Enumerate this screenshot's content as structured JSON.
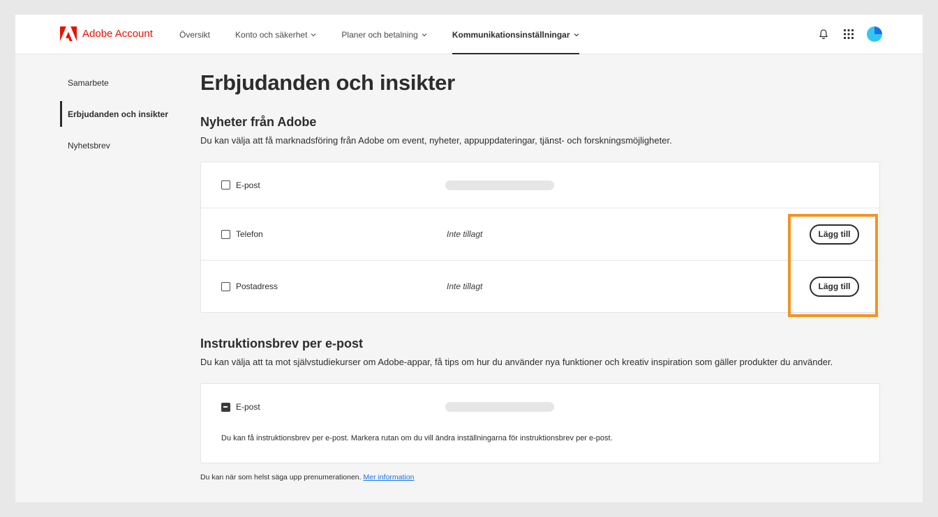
{
  "header": {
    "brand": "Adobe Account",
    "nav": [
      {
        "label": "Översikt",
        "dropdown": false,
        "active": false
      },
      {
        "label": "Konto och säkerhet",
        "dropdown": true,
        "active": false
      },
      {
        "label": "Planer och betalning",
        "dropdown": true,
        "active": false
      },
      {
        "label": "Kommunikationsinställningar",
        "dropdown": true,
        "active": true
      }
    ],
    "icons": [
      "bell-icon",
      "app-grid-icon",
      "avatar"
    ]
  },
  "sidebar": {
    "items": [
      {
        "label": "Samarbete",
        "active": false
      },
      {
        "label": "Erbjudanden och insikter",
        "active": true
      },
      {
        "label": "Nyhetsbrev",
        "active": false
      }
    ]
  },
  "main": {
    "title": "Erbjudanden och insikter",
    "news": {
      "title": "Nyheter från Adobe",
      "description": "Du kan välja att få marknadsföring från Adobe om event, nyheter, appuppdateringar, tjänst- och forskningsmöjligheter.",
      "rows": [
        {
          "label": "E-post",
          "value": "",
          "redacted": true,
          "checked": false
        },
        {
          "label": "Telefon",
          "value": "Inte tillagt",
          "button": "Lägg till",
          "checked": false
        },
        {
          "label": "Postadress",
          "value": "Inte tillagt",
          "button": "Lägg till",
          "checked": false
        }
      ]
    },
    "instructions": {
      "title": "Instruktionsbrev per e-post",
      "description": "Du kan välja att ta mot självstudiekurser om Adobe-appar, få tips om hur du använder nya funktioner och kreativ inspiration som gäller produkter du använder.",
      "row": {
        "label": "E-post",
        "redacted": true,
        "state": "indeterminate"
      },
      "note": "Du kan få instruktionsbrev per e-post. Markera rutan om du vill ändra inställningarna för instruktionsbrev per e-post."
    },
    "footer": {
      "text": "Du kan när som helst säga upp prenumerationen.",
      "link": "Mer information"
    }
  },
  "colors": {
    "brand_red": "#eb1000",
    "highlight_orange": "#f29423",
    "link_blue": "#1473e6"
  }
}
